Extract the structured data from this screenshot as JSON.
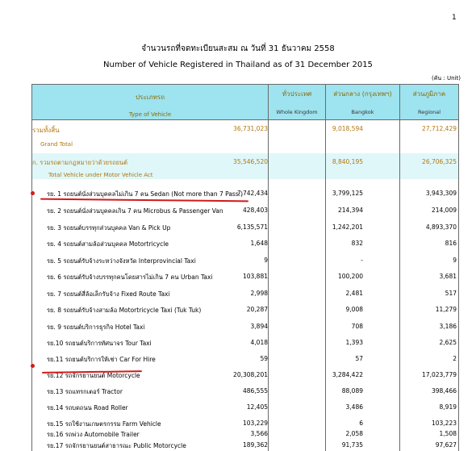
{
  "page_number": "1",
  "title_th": "จำนวนรถที่จดทะเบียนสะสม ณ วันที่ 31 ธันวาคม 2558",
  "title_en": "Number of Vehicle Registered in Thailand as of 31 December 2015",
  "unit": "(คัน : Unit)",
  "header": {
    "type_th": "ประเภทรถ",
    "type_en": "Type of Vehicle",
    "whole_th": "ทั่วประเทศ",
    "whole_en": "Whole Kingdom",
    "bkk_th": "ส่วนกลาง (กรุงเทพฯ)",
    "bkk_en": "Bangkok",
    "reg_th": "ส่วนภูมิภาค",
    "reg_en": "Regional"
  },
  "rows": [
    {
      "label": "รวมทั้งสิ้น",
      "whole": "36,731,023",
      "bkk": "9,018,594",
      "reg": "27,712,429"
    },
    {
      "label": "Grand Total",
      "whole": "",
      "bkk": "",
      "reg": ""
    },
    {
      "label": "ก. รวมรถตามกฎหมายว่าด้วยรถยนต์",
      "whole": "35,546,520",
      "bkk": "8,840,195",
      "reg": "26,706,325"
    },
    {
      "label": "Total Vehicle under Motor Vehicle Act",
      "whole": "",
      "bkk": "",
      "reg": ""
    },
    {
      "label": "รย. 1 รถยนต์นั่งส่วนบุคคลไม่เกิน 7 คน Sedan (Not more than 7 Pass.)",
      "whole": "7,742,434",
      "bkk": "3,799,125",
      "reg": "3,943,309"
    },
    {
      "label": "รย. 2 รถยนต์นั่งส่วนบุคคลเกิน 7 คน Microbus & Passenger Van",
      "whole": "428,403",
      "bkk": "214,394",
      "reg": "214,009"
    },
    {
      "label": "รย. 3 รถยนต์บรรทุกส่วนบุคคล Van & Pick Up",
      "whole": "6,135,571",
      "bkk": "1,242,201",
      "reg": "4,893,370"
    },
    {
      "label": "รย. 4 รถยนต์สามล้อส่วนบุคคล Motortricycle",
      "whole": "1,648",
      "bkk": "832",
      "reg": "816"
    },
    {
      "label": "รย. 5 รถยนต์รับจ้างระหว่างจังหวัด Interprovincial Taxi",
      "whole": "9",
      "bkk": "-",
      "reg": "9"
    },
    {
      "label": "รย. 6 รถยนต์รับจ้างบรรทุกคนโดยสารไม่เกิน 7 คน Urban Taxi",
      "whole": "103,881",
      "bkk": "100,200",
      "reg": "3,681"
    },
    {
      "label": "รย. 7 รถยนต์สี่ล้อเล็กรับจ้าง Fixed Route Taxi",
      "whole": "2,998",
      "bkk": "2,481",
      "reg": "517"
    },
    {
      "label": "รย. 8 รถยนต์รับจ้างสามล้อ Motortricycle Taxi (Tuk Tuk)",
      "whole": "20,287",
      "bkk": "9,008",
      "reg": "11,279"
    },
    {
      "label": "รย. 9 รถยนต์บริการธุรกิจ Hotel Taxi",
      "whole": "3,894",
      "bkk": "708",
      "reg": "3,186"
    },
    {
      "label": "รย.10 รถยนต์บริการทัศนาจร Tour Taxi",
      "whole": "4,018",
      "bkk": "1,393",
      "reg": "2,625"
    },
    {
      "label": "รย.11 รถยนต์บริการให้เช่า Car For Hire",
      "whole": "59",
      "bkk": "57",
      "reg": "2"
    },
    {
      "label": "รย.12 รถจักรยานยนต์ Motorcycle",
      "whole": "20,308,201",
      "bkk": "3,284,422",
      "reg": "17,023,779"
    },
    {
      "label": "รย.13 รถแทรกเตอร์ Tractor",
      "whole": "486,555",
      "bkk": "88,089",
      "reg": "398,466"
    },
    {
      "label": "รย.14 รถบดถนน Road Roller",
      "whole": "12,405",
      "bkk": "3,486",
      "reg": "8,919"
    },
    {
      "label": "รย.15 รถใช้งานเกษตรกรรม Farm Vehicle",
      "whole": "103,229",
      "bkk": "6",
      "reg": "103,223"
    },
    {
      "label": "รย.16 รถพ่วง Automobile Trailer",
      "whole": "3,566",
      "bkk": "2,058",
      "reg": "1,508"
    },
    {
      "label": "รย.17 รถจักรยานยนต์สาธารณะ Public Motorcycle",
      "whole": "189,362",
      "bkk": "91,735",
      "reg": "97,627"
    }
  ],
  "colors": {
    "header_bg": "#9ee3f0",
    "highlight_bg": "#dff7f9",
    "total_text": "#b2760e",
    "markup_red": "#d11a1a"
  }
}
